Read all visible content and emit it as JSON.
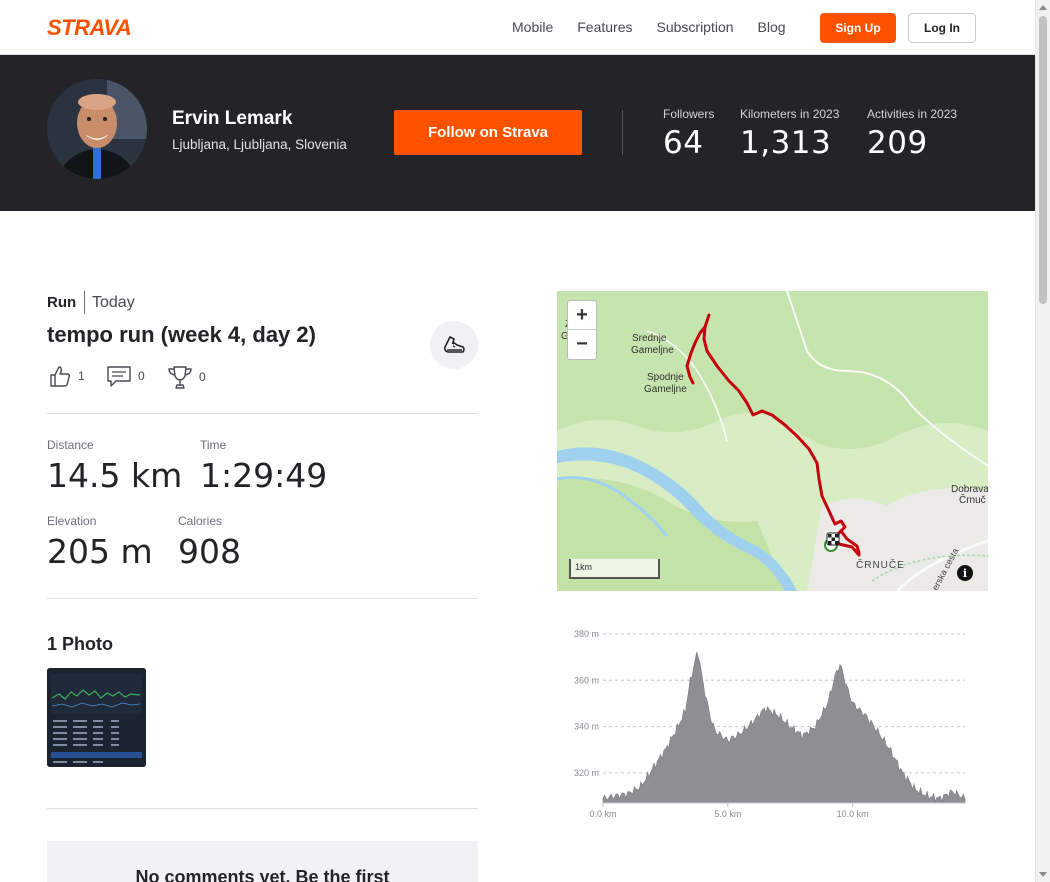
{
  "nav": {
    "logo_text": "STRAVA",
    "links": [
      "Mobile",
      "Features",
      "Subscription",
      "Blog"
    ],
    "signup_label": "Sign Up",
    "login_label": "Log In",
    "brand_color": "#fc5200"
  },
  "athlete": {
    "name": "Ervin Lemark",
    "location": "Ljubljana, Ljubljana, Slovenia",
    "follow_label": "Follow on Strava",
    "stats": [
      {
        "label": "Followers",
        "value": "64"
      },
      {
        "label": "Kilometers in 2023",
        "value": "1,313"
      },
      {
        "label": "Activities in 2023",
        "value": "209"
      }
    ]
  },
  "activity": {
    "type": "Run",
    "date": "Today",
    "title": "tempo run (week 4, day 2)",
    "kudos": "1",
    "comments": "0",
    "achievements": "0",
    "metrics": {
      "distance": {
        "label": "Distance",
        "value": "14.5 km"
      },
      "time": {
        "label": "Time",
        "value": "1:29:49"
      },
      "elevation": {
        "label": "Elevation",
        "value": "205 m"
      },
      "calories": {
        "label": "Calories",
        "value": "908"
      }
    },
    "photos_title": "1 Photo",
    "comments_empty": "No comments yet. Be the first"
  },
  "map": {
    "zoom_in": "+",
    "zoom_out": "−",
    "scale_label": "1km",
    "info": "i",
    "labels": {
      "srednje": "Srednje",
      "gameljne1": "Gameljne",
      "spodnje": "Spodnje",
      "gameljne2": "Gameljne",
      "zg1": "Z",
      "zg2": "G",
      "crnuce": "ČRNUČE",
      "dobrava": "Dobrava",
      "crnuce2": "Črnuč",
      "street": "erska cesta"
    }
  },
  "chart_data": {
    "type": "area",
    "ylabel": "",
    "xlabel": "",
    "y_ticks": [
      "380 m",
      "360 m",
      "340 m",
      "320 m"
    ],
    "x_ticks": [
      "0.0 km",
      "5.0 km",
      "10.0 km"
    ],
    "ylim": [
      307,
      380
    ],
    "xlim": [
      0,
      14.5
    ],
    "x": [
      0,
      0.5,
      1.0,
      1.5,
      2.0,
      2.5,
      3.0,
      3.3,
      3.5,
      3.8,
      4.0,
      4.3,
      4.5,
      5.0,
      5.5,
      6.0,
      6.5,
      7.0,
      7.5,
      8.0,
      8.5,
      9.0,
      9.3,
      9.5,
      9.8,
      10.0,
      10.5,
      11.0,
      11.5,
      12.0,
      12.5,
      13.0,
      13.5,
      14.0,
      14.5
    ],
    "y": [
      309,
      310,
      311,
      314,
      322,
      330,
      340,
      347,
      360,
      373,
      359,
      344,
      338,
      334,
      337,
      342,
      348,
      345,
      340,
      336,
      340,
      350,
      362,
      367,
      356,
      350,
      345,
      338,
      330,
      320,
      313,
      310,
      309,
      312,
      309
    ]
  }
}
